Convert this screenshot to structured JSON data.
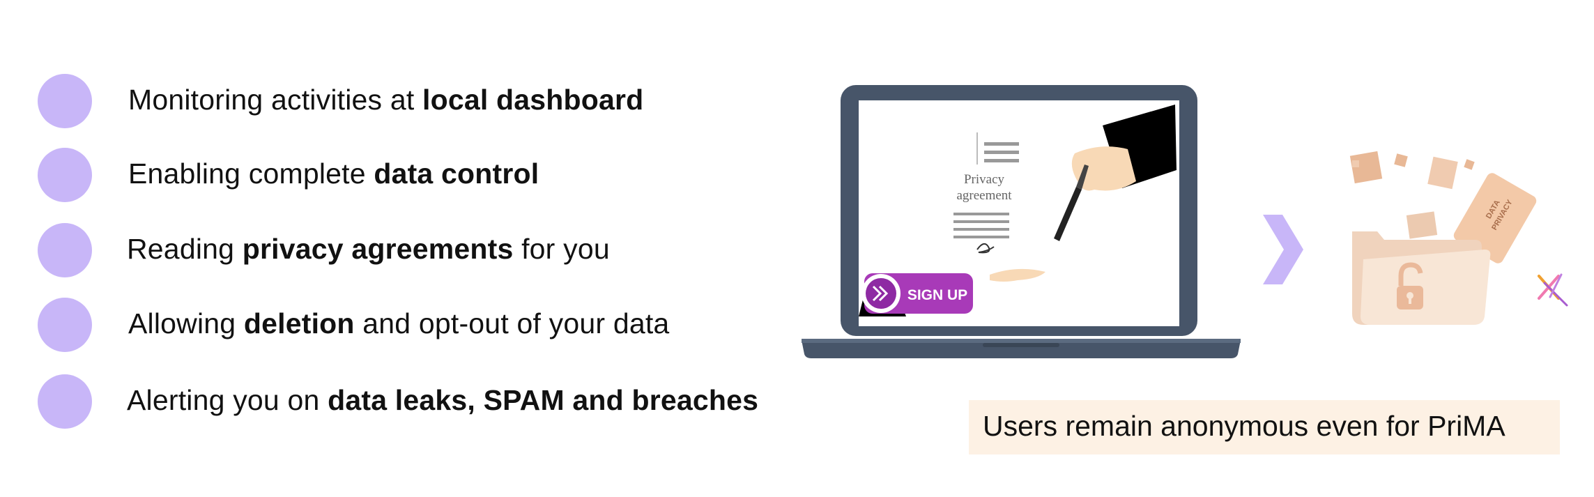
{
  "features": [
    {
      "pre": "Monitoring activities at ",
      "bold": "local dashboard",
      "post": ""
    },
    {
      "pre": "Enabling complete ",
      "bold": "data control",
      "post": ""
    },
    {
      "pre": "Reading ",
      "bold": "privacy agreements",
      "post": " for you"
    },
    {
      "pre": "Allowing ",
      "bold": "deletion",
      "post": " and opt-out of your data"
    },
    {
      "pre": "Alerting you on ",
      "bold": "data leaks, SPAM and breaches",
      "post": ""
    }
  ],
  "illustration": {
    "document_title_line1": "Privacy",
    "document_title_line2": "agreement",
    "signup_label": "SIGN UP",
    "folder_label_line1": "DATA",
    "folder_label_line2": "PRIVACY"
  },
  "caption": "Users remain anonymous even for PriMA",
  "colors": {
    "bullet": "#c8b6f8",
    "laptop": "#475569",
    "signup": "#a83ab8",
    "arrow": "#c8b6f8",
    "folder": "#f5dcc8",
    "caption_bg": "#fdf1e4"
  }
}
